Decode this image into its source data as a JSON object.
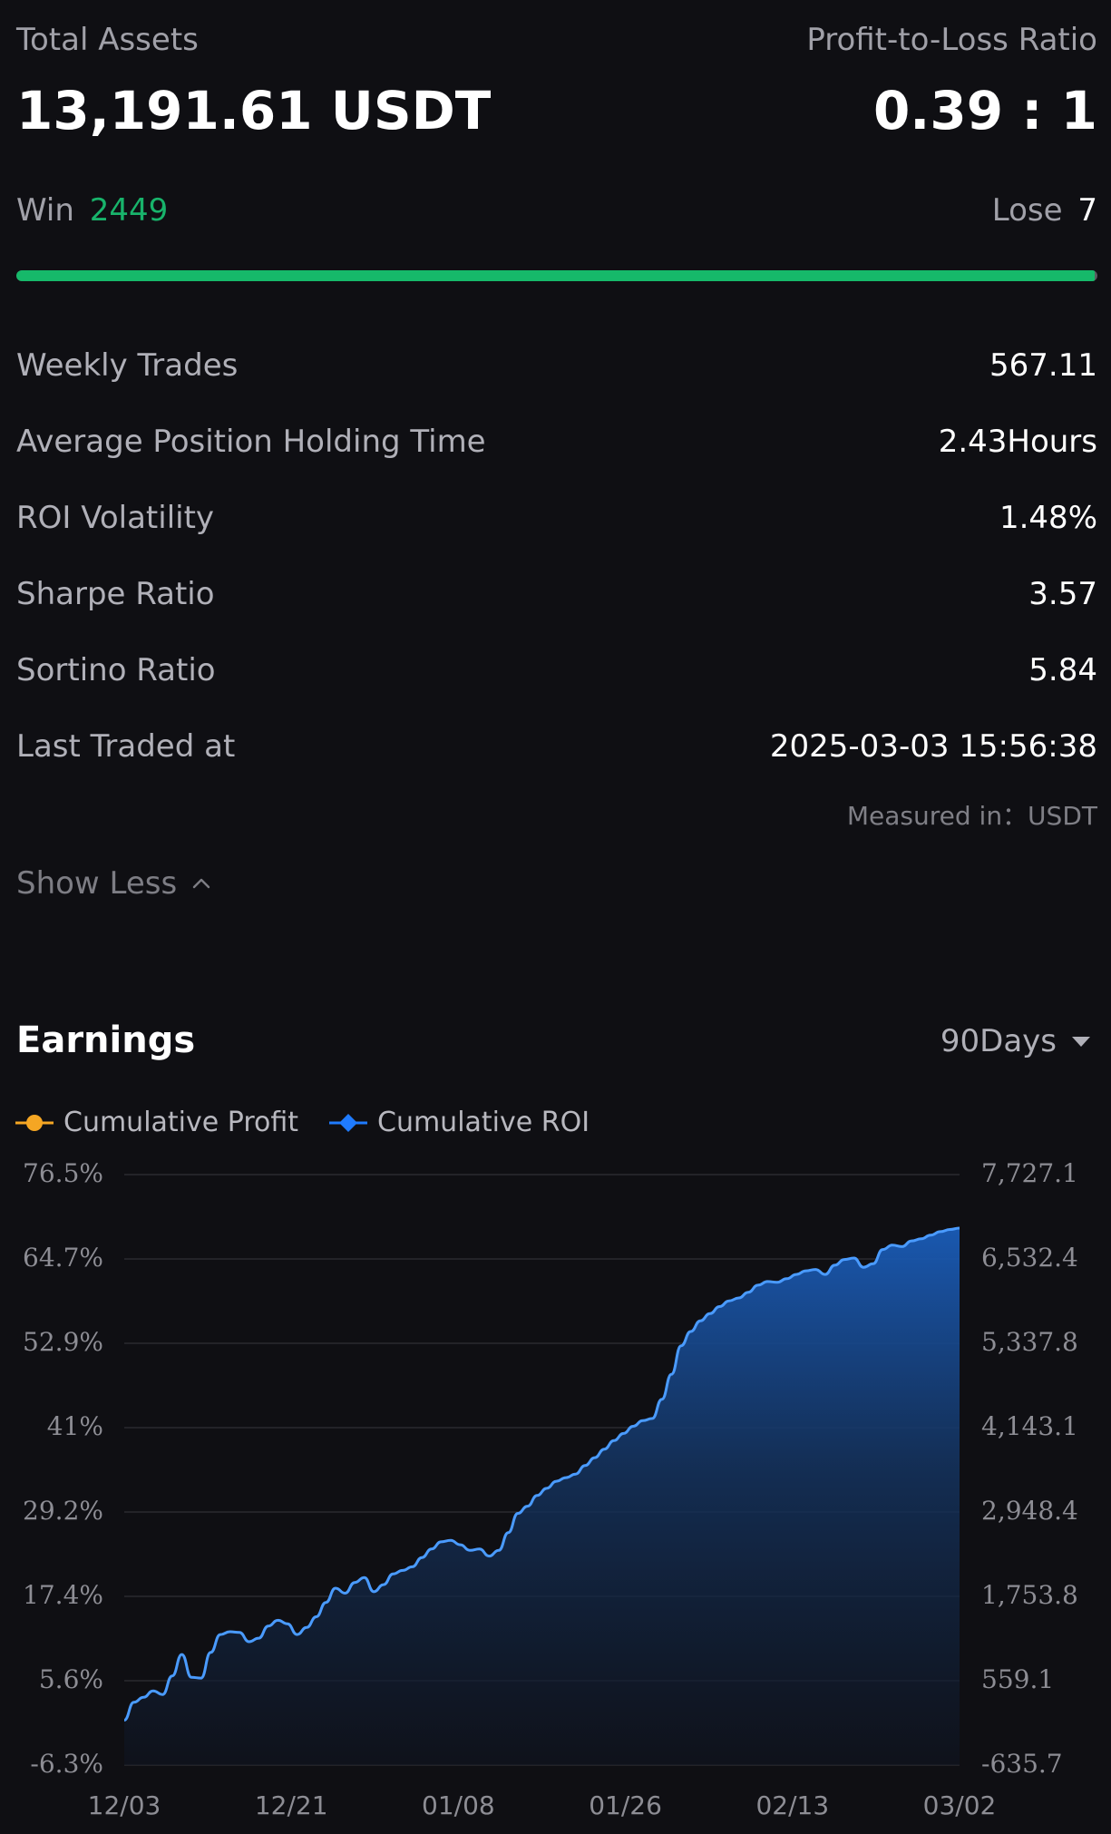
{
  "summary": {
    "total_assets_label": "Total Assets",
    "total_assets_value": "13,191.61 USDT",
    "pl_ratio_label": "Profit-to-Loss Ratio",
    "pl_ratio_value": "0.39 : 1",
    "win_label": "Win",
    "win_value": "2449",
    "lose_label": "Lose",
    "lose_value": "7",
    "win_fraction": 0.9971
  },
  "stats": [
    {
      "label": "Weekly Trades",
      "value": "567.11"
    },
    {
      "label": "Average Position Holding Time",
      "value": "2.43Hours"
    },
    {
      "label": "ROI Volatility",
      "value": "1.48%"
    },
    {
      "label": "Sharpe Ratio",
      "value": "3.57"
    },
    {
      "label": "Sortino Ratio",
      "value": "5.84"
    },
    {
      "label": "Last Traded at",
      "value": "2025-03-03 15:56:38"
    }
  ],
  "measured_in": "Measured in：USDT",
  "show_less_label": "Show Less",
  "earnings": {
    "title": "Earnings",
    "period_label": "90Days",
    "legend": [
      {
        "name": "Cumulative Profit",
        "color": "#f5a623",
        "icon": "circle-marker-icon"
      },
      {
        "name": "Cumulative ROI",
        "color": "#1f7bff",
        "icon": "diamond-marker-icon"
      }
    ]
  },
  "colors": {
    "accent_green": "#16b96a",
    "roi_line": "#4a9bff",
    "background": "#0f0f13"
  },
  "chart_data": {
    "type": "area",
    "y_left_ticks": [
      "76.5%",
      "64.7%",
      "52.9%",
      "41%",
      "29.2%",
      "17.4%",
      "5.6%",
      "-6.3%"
    ],
    "y_right_ticks": [
      "7,727.1",
      "6,532.4",
      "5,337.8",
      "4,143.1",
      "2,948.4",
      "1,753.8",
      "559.1",
      "-635.7"
    ],
    "x_ticks": [
      "12/03",
      "12/21",
      "01/08",
      "01/26",
      "02/13",
      "03/02"
    ],
    "ylim_left": [
      -6.3,
      76.5
    ],
    "grid": true,
    "series": [
      {
        "name": "Cumulative ROI",
        "values": [
          0.0,
          2.5,
          3.2,
          4.1,
          3.6,
          6.2,
          9.2,
          6.0,
          5.9,
          9.5,
          12.0,
          12.4,
          12.3,
          11.0,
          11.5,
          13.2,
          14.0,
          13.5,
          12.0,
          13.0,
          14.5,
          16.5,
          18.5,
          17.8,
          19.3,
          20.0,
          18.0,
          19.0,
          20.5,
          21.0,
          21.5,
          22.8,
          24.0,
          25.0,
          25.2,
          24.6,
          23.8,
          24.0,
          23.0,
          23.8,
          26.3,
          29.0,
          30.0,
          31.5,
          32.5,
          33.5,
          34.0,
          34.5,
          35.7,
          36.8,
          38.0,
          39.2,
          40.2,
          41.2,
          42.0,
          42.3,
          45.0,
          48.5,
          52.5,
          54.5,
          56.0,
          57.0,
          58.0,
          58.8,
          59.2,
          60.0,
          61.0,
          61.5,
          61.4,
          61.9,
          62.5,
          63.0,
          63.2,
          62.5,
          63.8,
          64.6,
          64.8,
          63.5,
          64.0,
          66.0,
          66.6,
          66.4,
          67.2,
          67.5,
          68.0,
          68.5,
          68.8,
          69.0
        ]
      }
    ]
  }
}
